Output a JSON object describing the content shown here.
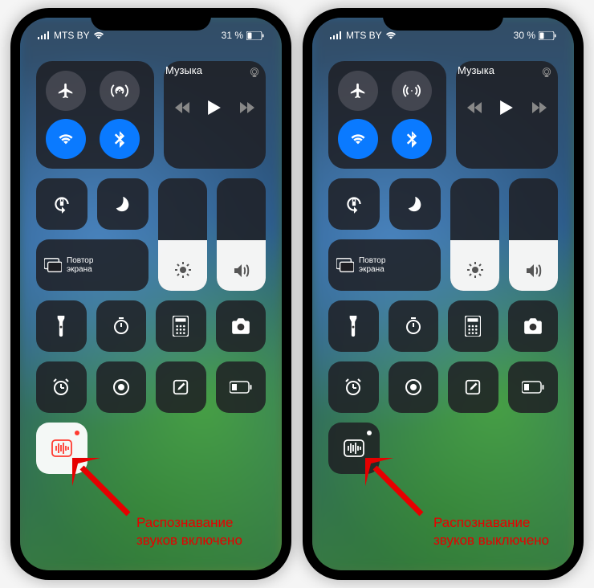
{
  "phones": [
    {
      "status": {
        "carrier": "MTS BY",
        "battery": "31 %"
      },
      "music": {
        "title": "Музыка"
      },
      "screen_mirror": "Повтор\nэкрана",
      "sound_on": true,
      "caption": "Распознавание\nзвуков включено"
    },
    {
      "status": {
        "carrier": "MTS BY",
        "battery": "30 %"
      },
      "music": {
        "title": "Музыка"
      },
      "screen_mirror": "Повтор\nэкрана",
      "sound_on": false,
      "caption": "Распознавание\nзвуков выключено"
    }
  ]
}
